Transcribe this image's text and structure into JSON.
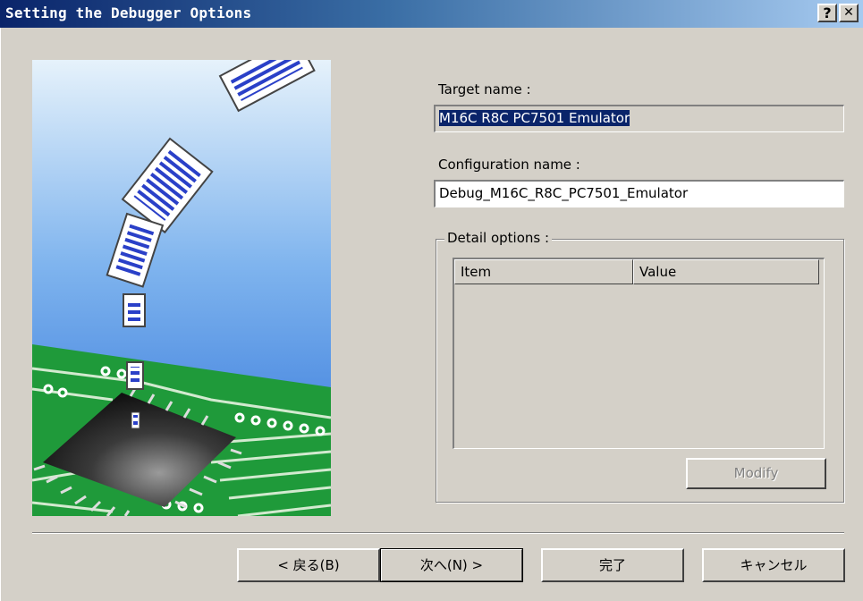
{
  "dialog": {
    "title": "Setting the Debugger Options",
    "help_glyph": "?",
    "close_glyph": "✕"
  },
  "form": {
    "target_label": "Target name :",
    "target_value": "M16C R8C PC7501 Emulator",
    "config_label": "Configuration name :",
    "config_value": "Debug_M16C_R8C_PC7501_Emulator",
    "detail_label": "Detail options :",
    "columns": [
      "Item",
      "Value"
    ],
    "modify_label": "Modify"
  },
  "buttons": {
    "back": "< 戻る(B)",
    "next": "次へ(N) >",
    "finish": "完了",
    "cancel": "キャンセル"
  },
  "colors": {
    "titlebar_start": "#0a246a",
    "dialog_face": "#d4d0c8",
    "sky": "#3a7ee0",
    "pcb_green": "#1f9a3a"
  }
}
